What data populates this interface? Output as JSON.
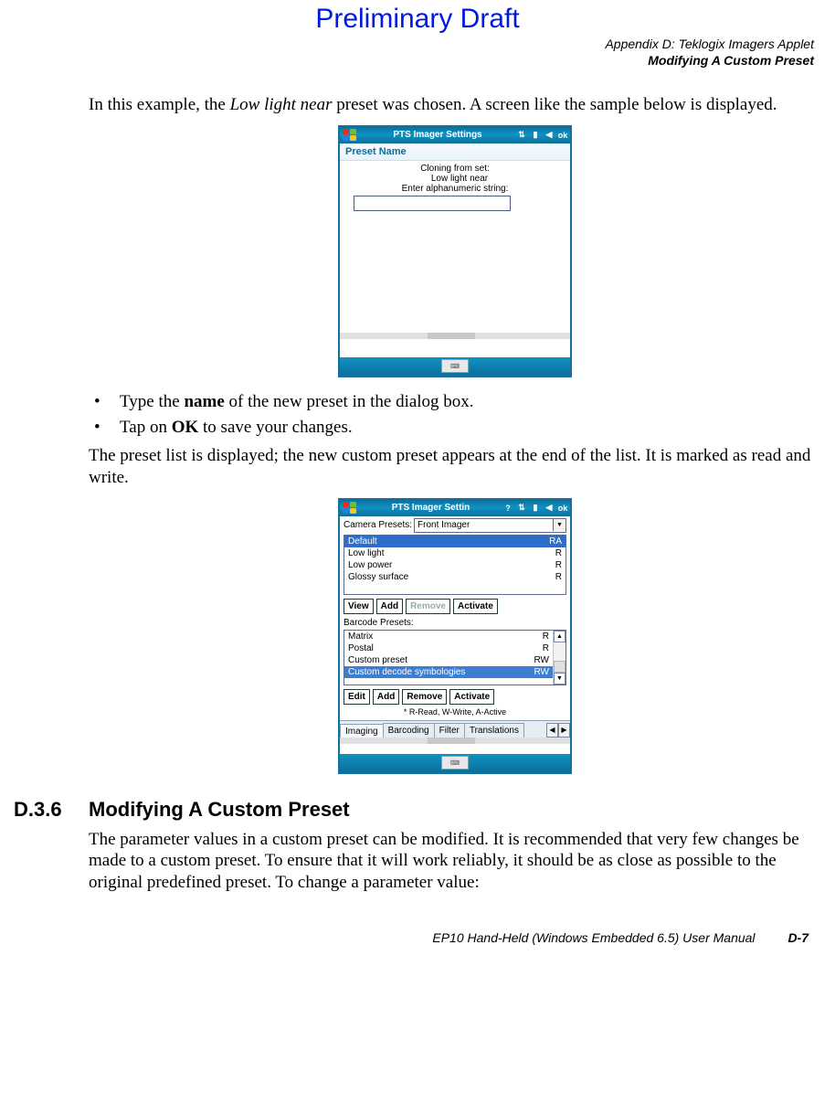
{
  "header": {
    "preliminary": "Preliminary Draft",
    "appendix_line1": "Appendix D: Teklogix Imagers Applet",
    "appendix_line2": "Modifying A Custom Preset"
  },
  "para1_a": "In this example, the ",
  "para1_b": "Low light near",
  "para1_c": " preset was chosen. A screen like the sample below is displayed.",
  "fig1": {
    "app_title": "PTS Imager Settings",
    "ok": "ok",
    "sub_title": "Preset Name",
    "line1": "Cloning from set:",
    "line2": "Low light near",
    "line3": "Enter alphanumeric string:"
  },
  "bullet1_pre": "Type the ",
  "bullet1_bold": "name",
  "bullet1_post": " of the new preset in the dialog box.",
  "bullet2_pre": "Tap on ",
  "bullet2_bold": "OK",
  "bullet2_post": " to save your changes.",
  "para2": "The preset list is displayed; the new custom preset appears at the end of the list. It is marked as read and write.",
  "fig2": {
    "app_title": "PTS Imager Settin",
    "ok": "ok",
    "camera_presets_label": "Camera Presets:",
    "camera_presets_value": "Front Imager",
    "camera_list": [
      {
        "name": "Default",
        "flag": "RA",
        "sel": true
      },
      {
        "name": "Low light",
        "flag": "R",
        "sel": false
      },
      {
        "name": "Low power",
        "flag": "R",
        "sel": false
      },
      {
        "name": "Glossy surface",
        "flag": "R",
        "sel": false
      }
    ],
    "buttons_top": [
      "View",
      "Add",
      "Remove",
      "Activate"
    ],
    "buttons_top_disabled": [
      false,
      false,
      true,
      false
    ],
    "barcode_presets_label": "Barcode Presets:",
    "barcode_list": [
      {
        "name": "Matrix",
        "flag": "R",
        "sel": false
      },
      {
        "name": "Postal",
        "flag": "R",
        "sel": false
      },
      {
        "name": "Custom preset",
        "flag": "RW",
        "sel": false
      },
      {
        "name": "Custom decode symbologies",
        "flag": "RW",
        "sel": true
      }
    ],
    "buttons_bottom": [
      "Edit",
      "Add",
      "Remove",
      "Activate"
    ],
    "legend": "* R-Read, W-Write, A-Active",
    "tabs": [
      "Imaging",
      "Barcoding",
      "Filter",
      "Translations"
    ],
    "active_tab": 0
  },
  "section": {
    "num": "D.3.6",
    "title": "Modifying A Custom Preset"
  },
  "para3": "The parameter values in a custom preset can be modified. It is recommended that very few changes be made to a custom preset. To ensure that it will work reliably, it should be as close as possible to the original predefined preset. To change a parameter value:",
  "footer": {
    "manual": "EP10 Hand-Held (Windows Embedded 6.5) User Manual",
    "page": "D-7"
  },
  "glyph": {
    "bullet": "•",
    "tri_down": "▼",
    "tri_up": "▲",
    "tri_left": "◀",
    "tri_right": "▶",
    "kbd": "⌨"
  },
  "start_colors": [
    "#e53015",
    "#6fbf2a",
    "#2a7de0",
    "#f7c22c"
  ],
  "icons": {
    "help": "?",
    "net": "⇅",
    "battery": "▮",
    "speaker": "◀"
  }
}
